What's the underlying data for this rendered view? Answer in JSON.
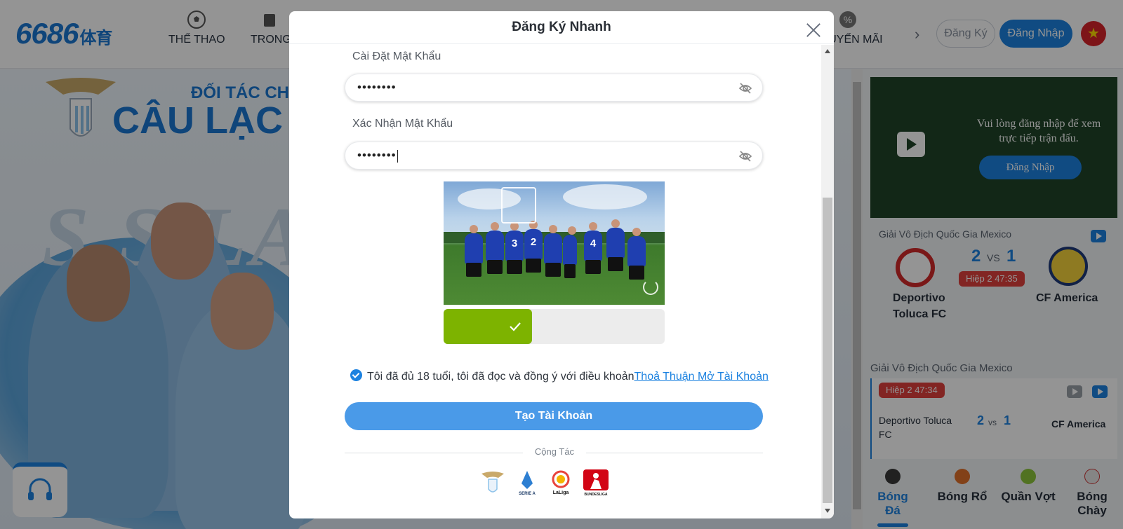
{
  "header": {
    "logo": "6686",
    "logo_suffix": "体育",
    "nav": [
      {
        "label": "THỂ THAO",
        "icon": "soccer-ball-icon"
      },
      {
        "label": "TRONG",
        "icon": "cards-icon"
      },
      {
        "label": "KHUYẾN MÃI",
        "icon": "promo-percent-icon"
      }
    ],
    "register_label": "Đăng Ký",
    "login_label": "Đăng Nhập",
    "flag_icon": "vietnam-flag-icon"
  },
  "banner": {
    "line1": "ĐỐI TÁC CH",
    "line2": "CÂU LẠC I",
    "watermark": "S.S.LA",
    "crest_text": "S.S.LAZIO"
  },
  "live": {
    "message": "Vui lòng đăng nhập để xem trực tiếp trận đấu.",
    "login_label": "Đăng Nhập"
  },
  "featured_match": {
    "league": "Giải Vô Địch Quốc Gia Mexico",
    "home": "Deportivo Toluca FC",
    "away": "CF America",
    "home_score": "2",
    "vs": "VS",
    "away_score": "1",
    "period": "Hiệp 2 47:35"
  },
  "match_list": {
    "league": "Giải Vô Địch Quốc Gia Mexico",
    "period": "Hiệp 2 47:34",
    "home": "Deportivo Toluca FC",
    "away": "CF America",
    "home_score": "2",
    "vs": "vs",
    "away_score": "1"
  },
  "sport_tabs": [
    {
      "label": "Bóng Đá",
      "color": "#3a3a3a",
      "active": true
    },
    {
      "label": "Bóng Rổ",
      "color": "#e0702a",
      "active": false
    },
    {
      "label": "Quần Vợt",
      "color": "#8cc43c",
      "active": false
    },
    {
      "label": "Bóng Chày",
      "color": "#e6e6e6",
      "active": false
    }
  ],
  "modal": {
    "title": "Đăng Ký Nhanh",
    "password_label": "Cài Đặt Mật Khẩu",
    "password_value": "••••••••",
    "confirm_label": "Xác Nhận Mật Khẩu",
    "confirm_value": "••••••••",
    "captcha_shirt_numbers": [
      "3",
      "2",
      "4"
    ],
    "slider_progress": 0.4,
    "agree_text": "Tôi đã đủ 18 tuổi, tôi đã đọc và đồng ý với điều khoản",
    "terms_link": "Thoả Thuận Mở Tài Khoản",
    "submit_label": "Tạo Tài Khoản",
    "partners_label": "Cộng Tác",
    "partners": [
      {
        "name": "SS Lazio",
        "icon": "lazio-logo-icon"
      },
      {
        "name": "SERIE A",
        "icon": "serie-a-logo-icon"
      },
      {
        "name": "LaLiga",
        "icon": "laliga-logo-icon"
      },
      {
        "name": "BUNDESLIGA",
        "icon": "bundesliga-logo-icon"
      }
    ]
  },
  "colors": {
    "brand_blue": "#1c82e0",
    "slider_green": "#7db300",
    "live_red": "#e0413d"
  }
}
